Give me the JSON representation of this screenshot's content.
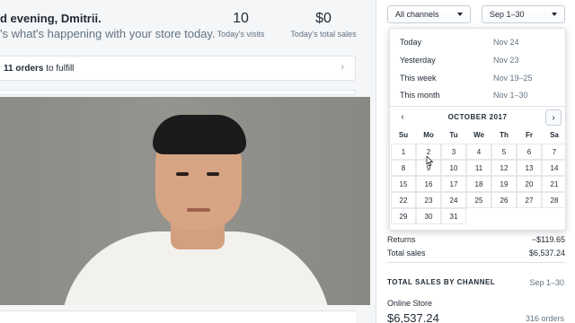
{
  "main": {
    "greeting": "d evening, Dmitrii.",
    "subtitle": "'s what's happening with your store today.",
    "stats": [
      {
        "value": "10",
        "label": "Today's visits"
      },
      {
        "value": "$0",
        "label": "Today's total sales"
      }
    ],
    "orders_card": {
      "count": "11 orders",
      "suffix": " to fulfill"
    }
  },
  "filters": {
    "channels": "All channels",
    "date_range": "Sep 1–30"
  },
  "date_popover": {
    "presets": [
      {
        "name": "Today",
        "range": "Nov 24"
      },
      {
        "name": "Yesterday",
        "range": "Nov 23"
      },
      {
        "name": "This week",
        "range": "Nov 19–25"
      },
      {
        "name": "This month",
        "range": "Nov 1–30"
      }
    ],
    "prev_icon": "‹",
    "next_icon": "›",
    "month_label": "OCTOBER 2017",
    "weekdays": [
      "Su",
      "Mo",
      "Tu",
      "We",
      "Th",
      "Fr",
      "Sa"
    ],
    "days": [
      "1",
      "2",
      "3",
      "4",
      "5",
      "6",
      "7",
      "8",
      "9",
      "10",
      "11",
      "12",
      "13",
      "14",
      "15",
      "16",
      "17",
      "18",
      "19",
      "20",
      "21",
      "22",
      "23",
      "24",
      "25",
      "26",
      "27",
      "28",
      "29",
      "30",
      "31"
    ]
  },
  "sidebar_report": {
    "returns_label": "Returns",
    "returns_value": "−$119.65",
    "total_sales_label": "Total sales",
    "total_sales_value": "$6,537.24",
    "channel_section_title": "TOTAL SALES BY CHANNEL",
    "channel_section_date": "Sep 1–30",
    "online_store_label": "Online Store",
    "online_store_sales": "$6,537.24",
    "online_store_orders": "316 orders"
  },
  "icons": {
    "chevron_right": "›"
  }
}
